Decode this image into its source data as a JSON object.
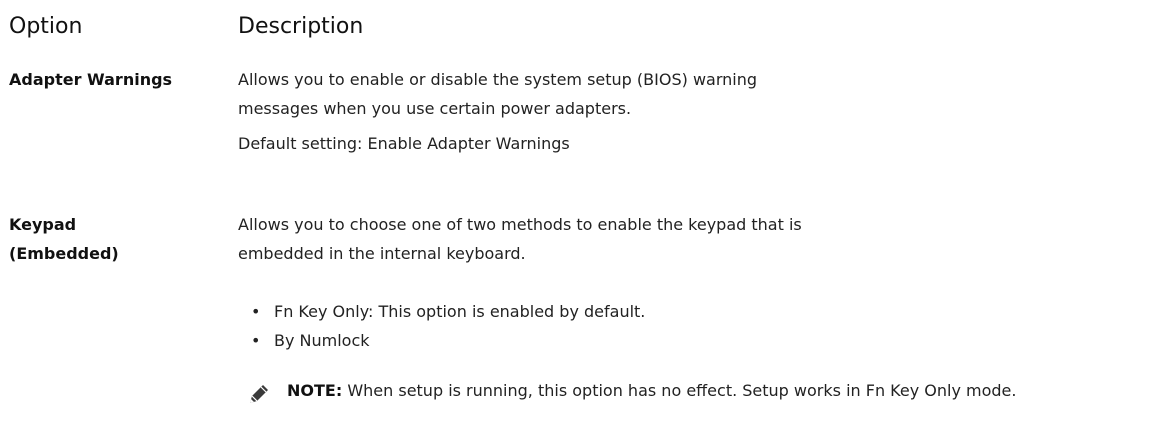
{
  "header": {
    "option_label": "Option",
    "description_label": "Description"
  },
  "options": [
    {
      "name": "Adapter Warnings",
      "description": "Allows you to enable or disable the system setup (BIOS) warning messages when you use certain power adapters.",
      "default": "Default setting: Enable Adapter Warnings"
    },
    {
      "name_line1": "Keypad",
      "name_line2": "(Embedded)",
      "description": "Allows you to choose one of two methods to enable the keypad that is embedded in the internal keyboard.",
      "bullets": [
        "Fn Key Only: This option is enabled by default.",
        "By Numlock"
      ],
      "note_label": "NOTE:",
      "note_text": " When setup is running, this option has no effect. Setup works in Fn Key Only mode.",
      "note_icon": "pencil-note-icon"
    }
  ]
}
